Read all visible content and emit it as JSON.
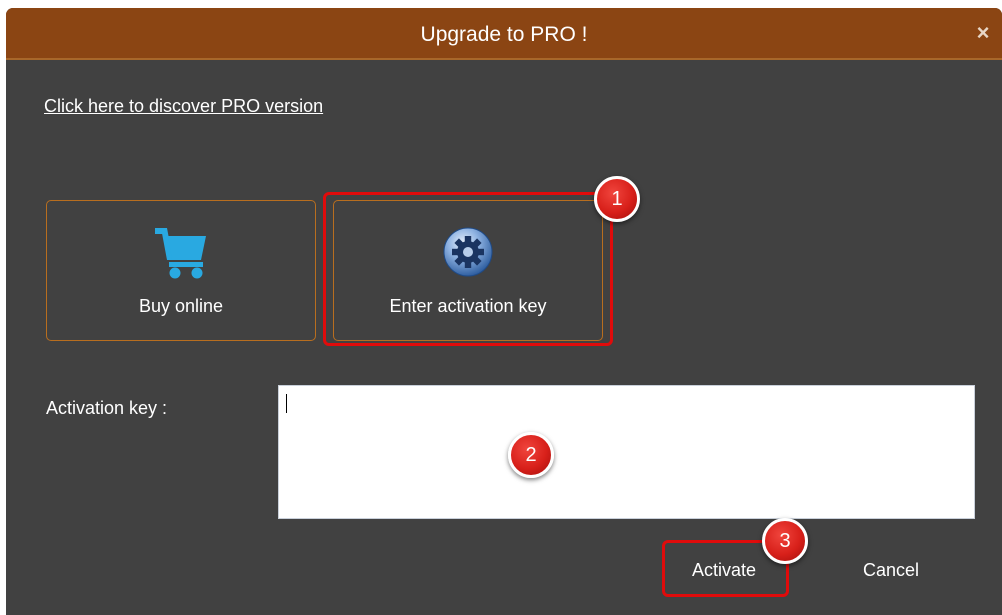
{
  "window": {
    "title": "Upgrade to PRO !",
    "close_glyph": "×"
  },
  "discover_link": "Click here to discover PRO version",
  "options": {
    "buy": {
      "label": "Buy online",
      "icon": "shopping-cart-icon"
    },
    "key": {
      "label": "Enter activation key",
      "icon": "gear-icon"
    }
  },
  "activation": {
    "label": "Activation key :",
    "value": ""
  },
  "buttons": {
    "activate": "Activate",
    "cancel": "Cancel"
  },
  "annotations": {
    "step1": "1",
    "step2": "2",
    "step3": "3"
  },
  "colors": {
    "titlebar": "#8b4513",
    "background": "#414141",
    "button_border": "#b86e1f",
    "highlight": "#e00b0b",
    "cart_icon": "#29a9e1"
  }
}
